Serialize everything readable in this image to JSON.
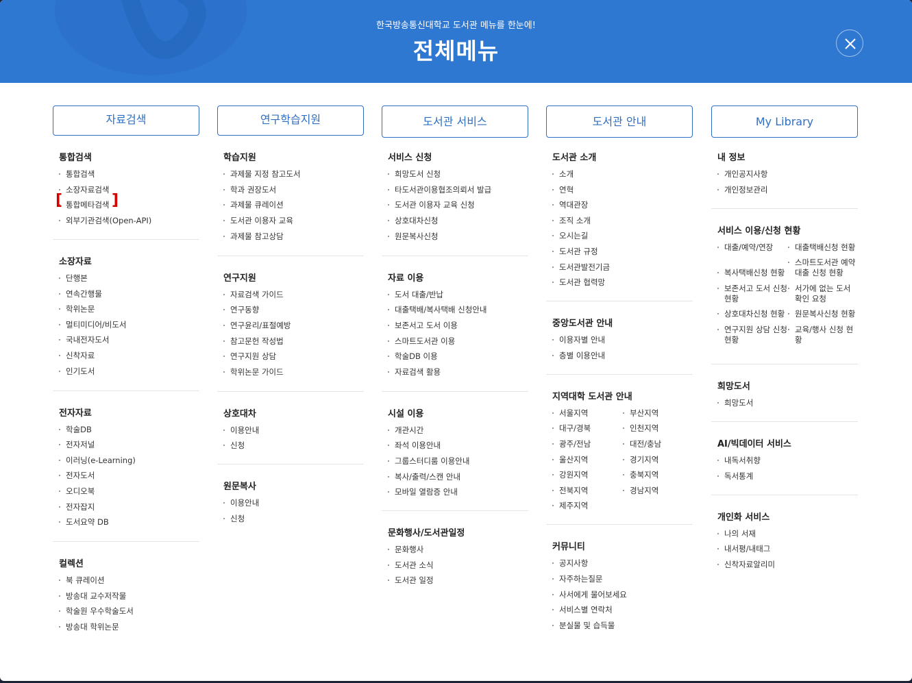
{
  "header": {
    "subtitle": "한국방송통신대학교 도서관 메뉴를 한눈에!",
    "title": "전체메뉴"
  },
  "columns": [
    {
      "label": "자료검색",
      "sections": [
        {
          "title": "통합검색",
          "items": [
            "통합검색",
            "소장자료검색",
            "통합메타검색",
            "외부기관검색(Open-API)"
          ]
        },
        {
          "title": "소장자료",
          "items": [
            "단행본",
            "연속간행물",
            "학위논문",
            "멀티미디어/비도서",
            "국내전자도서",
            "신착자료",
            "인기도서"
          ]
        },
        {
          "title": "전자자료",
          "items": [
            "학술DB",
            "전자저널",
            "이러닝(e-Learning)",
            "전자도서",
            "오디오북",
            "전자잡지",
            "도서요약 DB"
          ]
        },
        {
          "title": "컬렉션",
          "items": [
            "북 큐레이션",
            "방송대 교수저작물",
            "학술원 우수학술도서",
            "방송대 학위논문"
          ]
        }
      ]
    },
    {
      "label": "연구학습지원",
      "sections": [
        {
          "title": "학습지원",
          "items": [
            "과제물 지정 참고도서",
            "학과 권장도서",
            "과제물 큐레이션",
            "도서관 이용자 교육",
            "과제물 참고상담"
          ]
        },
        {
          "title": "연구지원",
          "items": [
            "자료검색 가이드",
            "연구동향",
            "연구윤리/표절예방",
            "참고문헌 작성법",
            "연구지원 상담",
            "학위논문 가이드"
          ]
        },
        {
          "title": "상호대차",
          "items": [
            "이용안내",
            "신청"
          ]
        },
        {
          "title": "원문복사",
          "items": [
            "이용안내",
            "신청"
          ]
        }
      ]
    },
    {
      "label": "도서관 서비스",
      "sections": [
        {
          "title": "서비스 신청",
          "items": [
            "희망도서 신청",
            "타도서관이용협조의뢰서 발급",
            "도서관 이용자 교육 신청",
            "상호대차신청",
            "원문복사신청"
          ]
        },
        {
          "title": "자료 이용",
          "items": [
            "도서 대출/반납",
            "대출택배/복사택배 신청안내",
            "보존서고 도서 이용",
            "스마트도서관 이용",
            "학술DB 이용",
            "자료검색 활용"
          ]
        },
        {
          "title": "시설 이용",
          "items": [
            "개관시간",
            "좌석 이용안내",
            "그룹스터디룸 이용안내",
            "복사/출력/스캔 안내",
            "모바일 열람증 안내"
          ]
        },
        {
          "title": "문화행사/도서관일정",
          "items": [
            "문화행사",
            "도서관 소식",
            "도서관 일정"
          ]
        }
      ]
    },
    {
      "label": "도서관 안내",
      "sections": [
        {
          "title": "도서관 소개",
          "items": [
            "소개",
            "연혁",
            "역대관장",
            "조직 소개",
            "오시는길",
            "도서관 규정",
            "도서관발전기금",
            "도서관 협력망"
          ]
        },
        {
          "title": "중앙도서관 안내",
          "items": [
            "이용자별 안내",
            "층별 이용안내"
          ]
        },
        {
          "title": "지역대학 도서관 안내",
          "items": [
            "서울지역",
            "부산지역",
            "대구/경북",
            "인천지역",
            "광주/전남",
            "대전/충남",
            "울산지역",
            "경기지역",
            "강원지역",
            "충북지역",
            "전북지역",
            "경남지역",
            "제주지역"
          ]
        },
        {
          "title": "커뮤니티",
          "items": [
            "공지사항",
            "자주하는질문",
            "사서에게 물어보세요",
            "서비스별 연락처",
            "분실물 및 습득물"
          ]
        }
      ]
    },
    {
      "label": "My Library",
      "sections": [
        {
          "title": "내 정보",
          "items": [
            "개인공지사항",
            "개인정보관리"
          ]
        },
        {
          "title": "서비스 이용/신청 현황",
          "items": [
            "대출/예약/연장",
            "대출택배신청 현황",
            "복사택배신청 현황",
            "스마트도서관 예약 대출 신청 현황",
            "보존서고 도서 신청 현황",
            "서가에 없는 도서 확인 요청",
            "상호대차신청 현황",
            "원문복사신청 현황",
            "연구지원 상담 신청 현황",
            "교육/행사 신청 현황"
          ]
        },
        {
          "title": "희망도서",
          "items": [
            "희망도서"
          ]
        },
        {
          "title": "AI/빅데이터 서비스",
          "items": [
            "내독서취향",
            "독서통계"
          ]
        },
        {
          "title": "개인화 서비스",
          "items": [
            "나의 서재",
            "내서평/내태그",
            "신착자료알리미"
          ]
        }
      ]
    }
  ]
}
